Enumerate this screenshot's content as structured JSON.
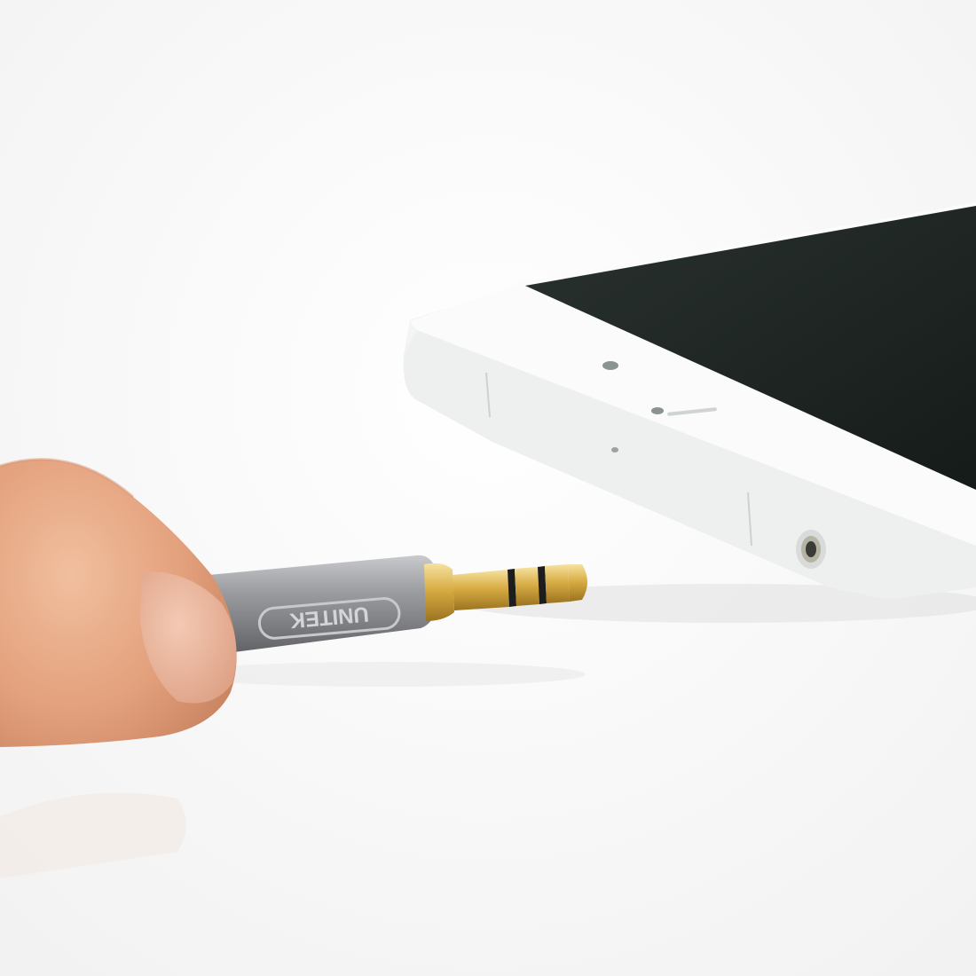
{
  "photo": {
    "background_color": "#ffffff",
    "plug": {
      "brand_text": "UNITEK",
      "barrel_color": "#8e9094",
      "contact_color": "#d9b24a"
    },
    "phone": {
      "body_color": "#f4f5f4",
      "screen_color": "#1d2522"
    },
    "finger": {
      "skin_color": "#e8aa84"
    }
  }
}
